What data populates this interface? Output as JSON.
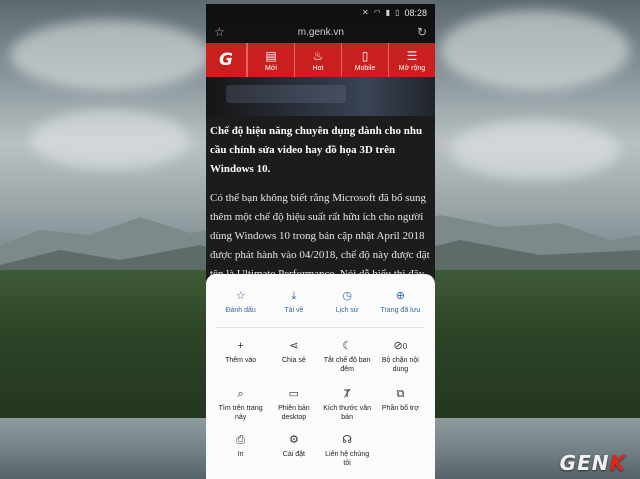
{
  "status_bar": {
    "time": "08:28"
  },
  "browser": {
    "url": "m.genk.vn"
  },
  "site_nav": {
    "logo": "G",
    "items": [
      {
        "label": "Mới",
        "icon": "document-icon"
      },
      {
        "label": "Hot",
        "icon": "fire-icon"
      },
      {
        "label": "Mobile",
        "icon": "phone-icon"
      },
      {
        "label": "Mở rộng",
        "icon": "menu-icon"
      }
    ]
  },
  "article": {
    "headline": "Chế độ hiệu năng chuyên dụng dành cho nhu cầu chỉnh sửa video hay đồ họa 3D trên Windows 10.",
    "body": "Có thể bạn không biết rằng Microsoft đã bổ sung thêm một chế độ hiệu suất rất hữu ích cho người dùng Windows 10 trong bản cập nhật April 2018 được phát hành vào 04/2018, chế độ này được đặt tên là Ultimate Performance. Nói dễ hiểu thì đây là chế độ dành cho người dùng mong muốn có"
  },
  "menu": {
    "top": [
      {
        "label": "Đánh dấu",
        "icon": "star-icon"
      },
      {
        "label": "Tải về",
        "icon": "download-icon"
      },
      {
        "label": "Lịch sử",
        "icon": "clock-icon"
      },
      {
        "label": "Trang đã lưu",
        "icon": "globe-icon"
      }
    ],
    "row1": [
      {
        "label": "Thêm vào",
        "icon": "plus-icon"
      },
      {
        "label": "Chia sẻ",
        "icon": "share-icon"
      },
      {
        "label": "Tắt chế độ ban đêm",
        "icon": "moon-icon"
      },
      {
        "label": "Bộ chặn nội dung",
        "icon": "block-icon",
        "badge": "0"
      }
    ],
    "row2": [
      {
        "label": "Tìm trên trang này",
        "icon": "find-in-page-icon"
      },
      {
        "label": "Phiên bản desktop",
        "icon": "desktop-icon"
      },
      {
        "label": "Kích thước văn bản",
        "icon": "text-size-icon"
      },
      {
        "label": "Phần bổ trợ",
        "icon": "puzzle-icon"
      }
    ],
    "row3": [
      {
        "label": "In",
        "icon": "printer-icon"
      },
      {
        "label": "Cài đặt",
        "icon": "gear-icon"
      },
      {
        "label": "Liên hệ chúng tôi",
        "icon": "headset-icon"
      }
    ]
  },
  "watermark": {
    "text_main": "GEN",
    "text_accent": "K"
  },
  "colors": {
    "brand_red": "#c9201f",
    "menu_accent": "#3366a9"
  }
}
